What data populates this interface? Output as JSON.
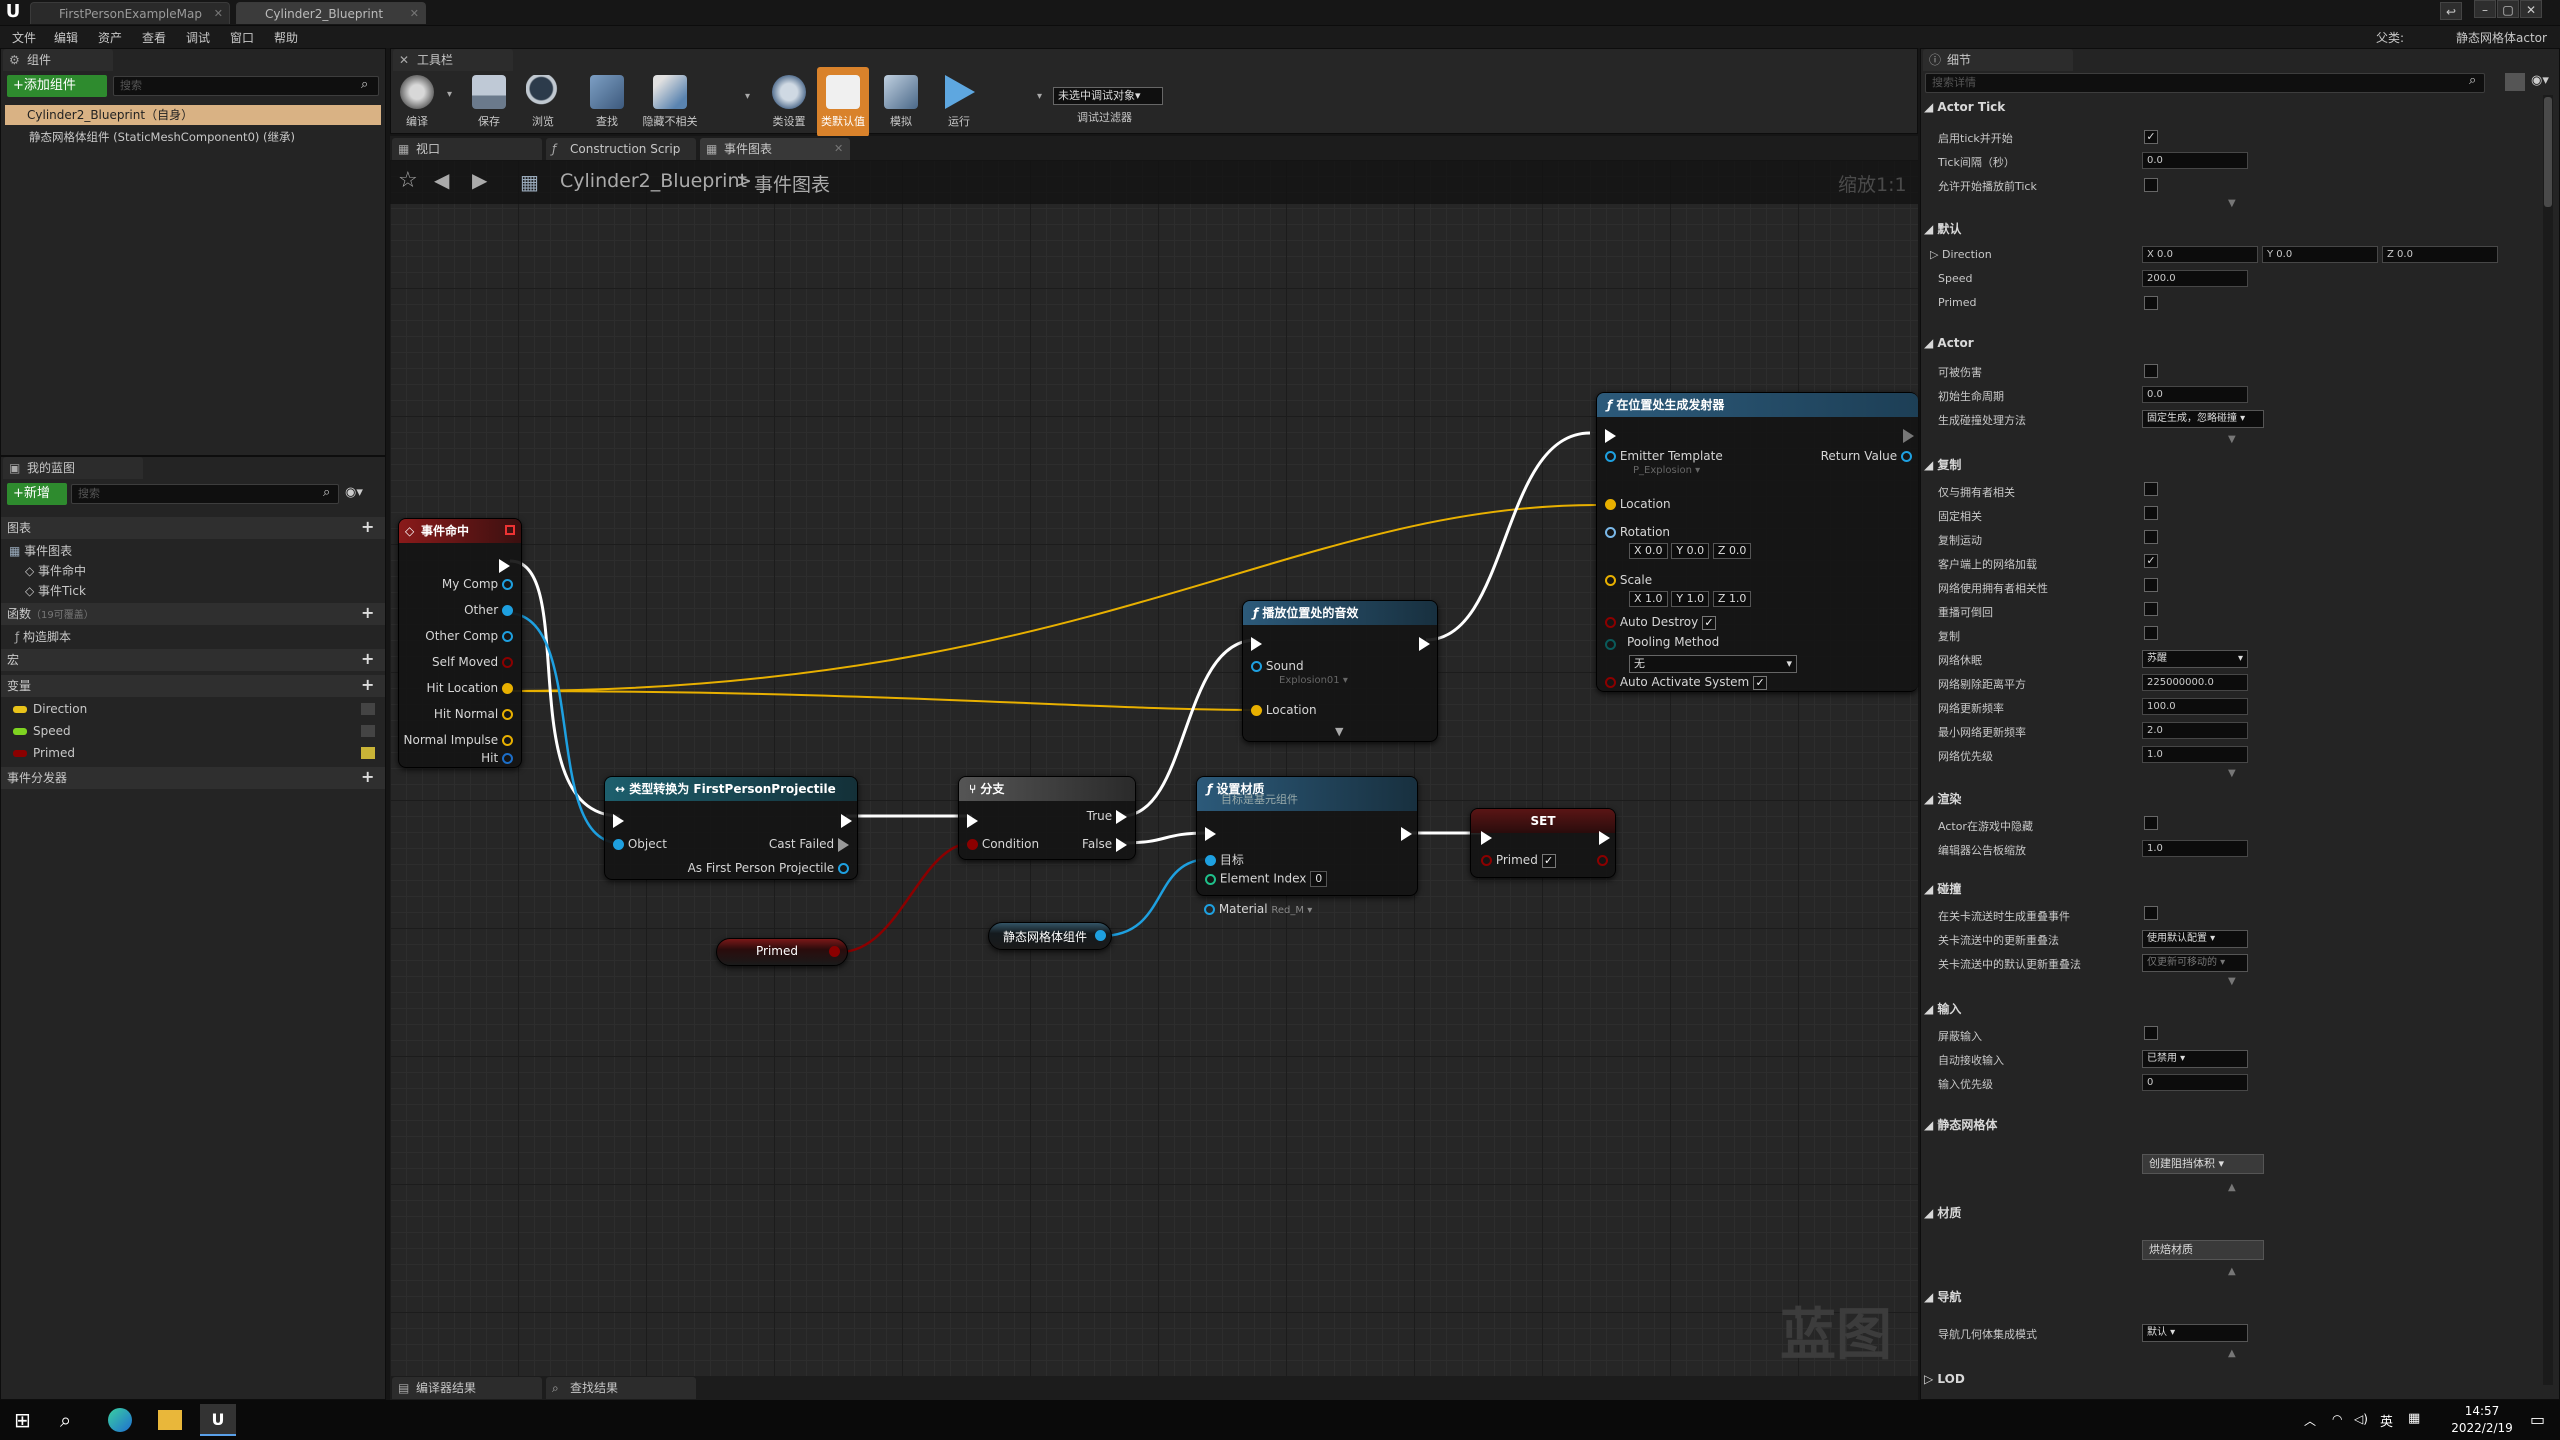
{
  "titlebar": {
    "tabs": [
      "FirstPersonExampleMap",
      "Cylinder2_Blueprint"
    ]
  },
  "menu": [
    "文件",
    "编辑",
    "资产",
    "查看",
    "调试",
    "窗口",
    "帮助"
  ],
  "topright": {
    "parent_label": "父类:",
    "parent_value": "静态网格体actor"
  },
  "components": {
    "tab": "组件",
    "add_button": "+添加组件",
    "search_placeholder": "搜索",
    "root_item": "Cylinder2_Blueprint（自身）",
    "child_item": "静态网格体组件 (StaticMeshComponent0) (继承)"
  },
  "mybp": {
    "tab": "我的蓝图",
    "new_button": "+新增",
    "search_placeholder": "搜索",
    "graphs_label": "图表",
    "eventgraph_label": "事件图表",
    "event_hit": "事件命中",
    "event_tick": "事件Tick",
    "functions_label": "函数",
    "functions_count": "（19可覆盖）",
    "construction_script": "构造脚本",
    "macros_label": "宏",
    "variables_label": "变量",
    "variables": [
      {
        "name": "Direction",
        "color": "#e8c31a"
      },
      {
        "name": "Speed",
        "color": "#7ed321"
      },
      {
        "name": "Primed",
        "color": "#8b0000"
      }
    ],
    "dispatchers_label": "事件分发器"
  },
  "toolbar": {
    "tab": "工具栏",
    "buttons": [
      "编译",
      "保存",
      "浏览",
      "查找",
      "隐藏不相关",
      "类设置",
      "类默认值",
      "模拟",
      "运行"
    ],
    "debug_dropdown": "未选中调试对象▾",
    "debug_filter": "调试过滤器"
  },
  "graph_tabs": [
    "视口",
    "Construction Scrip",
    "事件图表"
  ],
  "breadcrumb": {
    "blueprint": "Cylinder2_Blueprint",
    "separator": ">",
    "graph": "事件图表",
    "zoom": "缩放1:1"
  },
  "watermark": "蓝图",
  "nodes": {
    "event_hit": {
      "title": "事件命中",
      "pins": [
        "My Comp",
        "Other",
        "Other Comp",
        "Self Moved",
        "Hit Location",
        "Hit Normal",
        "Normal Impulse",
        "Hit"
      ]
    },
    "cast": {
      "title": "类型转换为 FirstPersonProjectile",
      "object": "Object",
      "cast_failed": "Cast Failed",
      "as_fpp": "As First Person Projectile"
    },
    "branch": {
      "title": "分支",
      "condition": "Condition",
      "true": "True",
      "false": "False"
    },
    "primed_getter": "Primed",
    "mesh_getter": "静态网格体组件",
    "set_material": {
      "title": "设置材质",
      "subtitle": "目标是基元组件",
      "target": "目标",
      "element_index": "Element Index",
      "element_value": "0",
      "material": "Material",
      "material_value": "Red_M ▾"
    },
    "set_node": {
      "title": "SET",
      "primed": "Primed"
    },
    "play_sound": {
      "title": "播放位置处的音效",
      "sound": "Sound",
      "sound_value": "Explosion01 ▾",
      "location": "Location"
    },
    "spawn_emitter": {
      "title": "在位置处生成发射器",
      "emitter_template": "Emitter Template",
      "emitter_value": "P_Explosion ▾",
      "return_value": "Return Value",
      "location": "Location",
      "rotation": "Rotation",
      "rotation_values": [
        "X 0.0",
        "Y 0.0",
        "Z 0.0"
      ],
      "scale": "Scale",
      "scale_values": [
        "X 1.0",
        "Y 1.0",
        "Z 1.0"
      ],
      "auto_destroy": "Auto Destroy",
      "pooling_method": "Pooling Method",
      "pooling_value": "无",
      "auto_activate": "Auto Activate System"
    }
  },
  "bottom_tabs": [
    "编译器结果",
    "查找结果"
  ],
  "details": {
    "tab": "细节",
    "search_placeholder": "搜索详情",
    "sections": {
      "actor_tick": "Actor Tick",
      "default": "默认",
      "actor": "Actor",
      "replication": "复制",
      "rendering": "渲染",
      "collision": "碰撞",
      "input": "输入",
      "static_mesh": "静态网格体",
      "materials": "材质",
      "navigation": "导航",
      "lod": "LOD"
    },
    "tick": {
      "start_label": "启用tick并开始",
      "interval_label": "Tick间隔（秒）",
      "interval_value": "0.0",
      "allow_before_label": "允许开始播放前Tick"
    },
    "default": {
      "direction_label": "Direction",
      "dir_x": "X 0.0",
      "dir_y": "Y 0.0",
      "dir_z": "Z 0.0",
      "speed_label": "Speed",
      "speed_value": "200.0",
      "primed_label": "Primed"
    },
    "actor": {
      "damage_label": "可被伤害",
      "lifespan_label": "初始生命周期",
      "lifespan_value": "0.0",
      "spawn_collision_label": "生成碰撞处理方法",
      "spawn_collision_value": "固定生成，忽略碰撞 ▾"
    },
    "replication": {
      "labels": [
        "仅与拥有者相关",
        "固定相关",
        "复制运动",
        "客户端上的网络加载",
        "网络使用拥有者相关性",
        "重播可倒回",
        "复制",
        "网络休眠",
        "网络剔除距离平方",
        "网络更新频率",
        "最小网络更新频率",
        "网络优先级"
      ],
      "dormancy_value": "苏醒",
      "cull_value": "225000000.0",
      "update_value": "100.0",
      "min_update_value": "2.0",
      "priority_value": "1.0"
    },
    "rendering": {
      "hidden_label": "Actor在游戏中隐藏",
      "billboard_label": "编辑器公告板缩放",
      "billboard_value": "1.0"
    },
    "collision": {
      "overlap_label": "在关卡流送时生成重叠事件",
      "update_label": "关卡流送中的更新重叠法",
      "update_value": "使用默认配置 ▾",
      "default_label": "关卡流送中的默认更新重叠法",
      "default_value": "仅更新可移动的 ▾"
    },
    "input": {
      "block_label": "屏蔽输入",
      "auto_label": "自动接收输入",
      "auto_value": "已禁用 ▾",
      "priority_label": "输入优先级",
      "priority_value": "0"
    },
    "static_mesh_btn": "创建阻挡体积 ▾",
    "material_btn": "烘焙材质",
    "navigation": {
      "label": "导航几何体集成模式",
      "value": "默认 ▾"
    }
  },
  "taskbar": {
    "time": "14:57",
    "date": "2022/2/19",
    "ime": "英"
  },
  "colors": {
    "event_head": "#8a1a1a",
    "func_head": "#2c5a7a",
    "cast_head": "#1d5f6d",
    "branch_head": "#555555",
    "exec_wire": "#ffffff",
    "struct_wire": "#e8b000",
    "object_wire": "#1ea0e0",
    "bool_wire": "#8b0000"
  }
}
